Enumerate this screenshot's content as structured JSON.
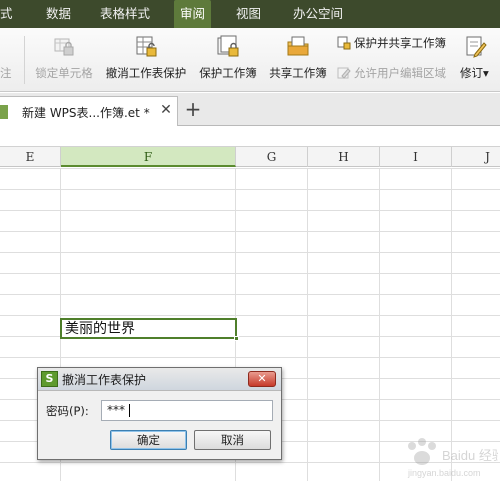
{
  "menu": {
    "items": [
      "式",
      "数据",
      "表格样式",
      "审阅",
      "视图",
      "办公空间"
    ],
    "active": "审阅"
  },
  "ribbon": {
    "partial_label": "注",
    "lock_cell": "锁定单元格",
    "unprotect_sheet": "撤消工作表保护",
    "protect_workbook": "保护工作簿",
    "share_workbook": "共享工作簿",
    "protect_and_share": "保护并共享工作簿",
    "allow_edit_ranges": "允许用户编辑区域",
    "track_changes": "修订",
    "track_changes_arrow": "▾"
  },
  "tabs": {
    "document_title": "新建 WPS表...作簿.et *",
    "close_glyph": "✕",
    "new_tab_glyph": "+"
  },
  "sheet": {
    "columns": [
      "E",
      "F",
      "G",
      "H",
      "I",
      "J"
    ],
    "selected_column": "F",
    "active_cell_text": "美丽的世界"
  },
  "dialog": {
    "icon_glyph": "S",
    "title": "撤消工作表保护",
    "close_glyph": "✕",
    "password_label": "密码(P):",
    "password_value": "***",
    "ok_label": "确定",
    "cancel_label": "取消"
  },
  "watermark": {
    "text": "Baidu 经验",
    "subtext": "jingyan.baidu.com"
  },
  "colors": {
    "menubar_bg": "#3d4a2c",
    "menubar_active": "#5e7a3b",
    "selection_green": "#4f7f2b",
    "column_selected_bg": "#d3e8c0"
  }
}
